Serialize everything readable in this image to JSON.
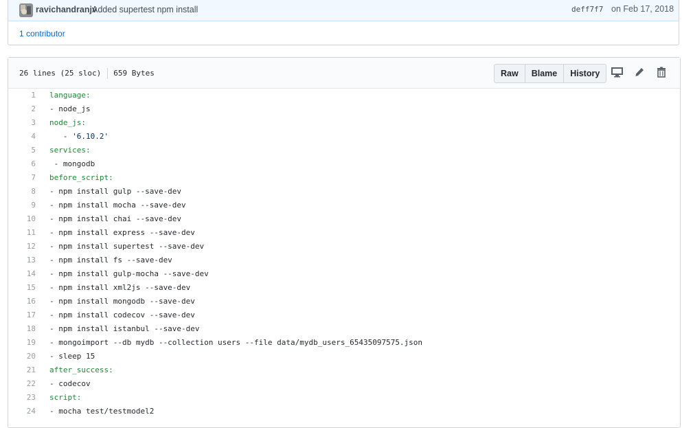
{
  "commit": {
    "author": "ravichandranjv",
    "message": "Added supertest npm install",
    "sha": "deff7f7",
    "date": "on Feb 17, 2018",
    "contributors": "1 contributor"
  },
  "file": {
    "lines_info": "26 lines (25 sloc)",
    "size": "659 Bytes",
    "buttons": {
      "raw": "Raw",
      "blame": "Blame",
      "history": "History"
    }
  },
  "code_lines": [
    {
      "n": "1",
      "text": "language:",
      "type": "key"
    },
    {
      "n": "2",
      "text": "- node_js",
      "type": "plain"
    },
    {
      "n": "3",
      "text": "node_js:",
      "type": "key"
    },
    {
      "n": "4",
      "text": "   - '6.10.2'",
      "type": "str"
    },
    {
      "n": "5",
      "text": "services:",
      "type": "key"
    },
    {
      "n": "6",
      "text": " - mongodb",
      "type": "plain"
    },
    {
      "n": "7",
      "text": "before_script:",
      "type": "key"
    },
    {
      "n": "8",
      "text": "- npm install gulp --save-dev",
      "type": "plain"
    },
    {
      "n": "9",
      "text": "- npm install mocha --save-dev",
      "type": "plain"
    },
    {
      "n": "10",
      "text": "- npm install chai --save-dev",
      "type": "plain"
    },
    {
      "n": "11",
      "text": "- npm install express --save-dev",
      "type": "plain"
    },
    {
      "n": "12",
      "text": "- npm install supertest --save-dev",
      "type": "plain"
    },
    {
      "n": "13",
      "text": "- npm install fs --save-dev",
      "type": "plain"
    },
    {
      "n": "14",
      "text": "- npm install gulp-mocha --save-dev",
      "type": "plain"
    },
    {
      "n": "15",
      "text": "- npm install xml2js --save-dev",
      "type": "plain"
    },
    {
      "n": "16",
      "text": "- npm install mongodb --save-dev",
      "type": "plain"
    },
    {
      "n": "17",
      "text": "- npm install codecov --save-dev",
      "type": "plain"
    },
    {
      "n": "18",
      "text": "- npm install istanbul --save-dev",
      "type": "plain"
    },
    {
      "n": "19",
      "text": "- mongoimport --db mydb --collection users --file data/mydb_users_65435097575.json",
      "type": "plain"
    },
    {
      "n": "20",
      "text": "- sleep 15",
      "type": "plain"
    },
    {
      "n": "21",
      "text": "after_success:",
      "type": "key"
    },
    {
      "n": "22",
      "text": "- codecov",
      "type": "plain"
    },
    {
      "n": "23",
      "text": "script:",
      "type": "key"
    },
    {
      "n": "24",
      "text": "- mocha test/testmodel2",
      "type": "plain"
    }
  ],
  "icons": [
    "desktop-icon",
    "pencil-icon",
    "trash-icon"
  ]
}
